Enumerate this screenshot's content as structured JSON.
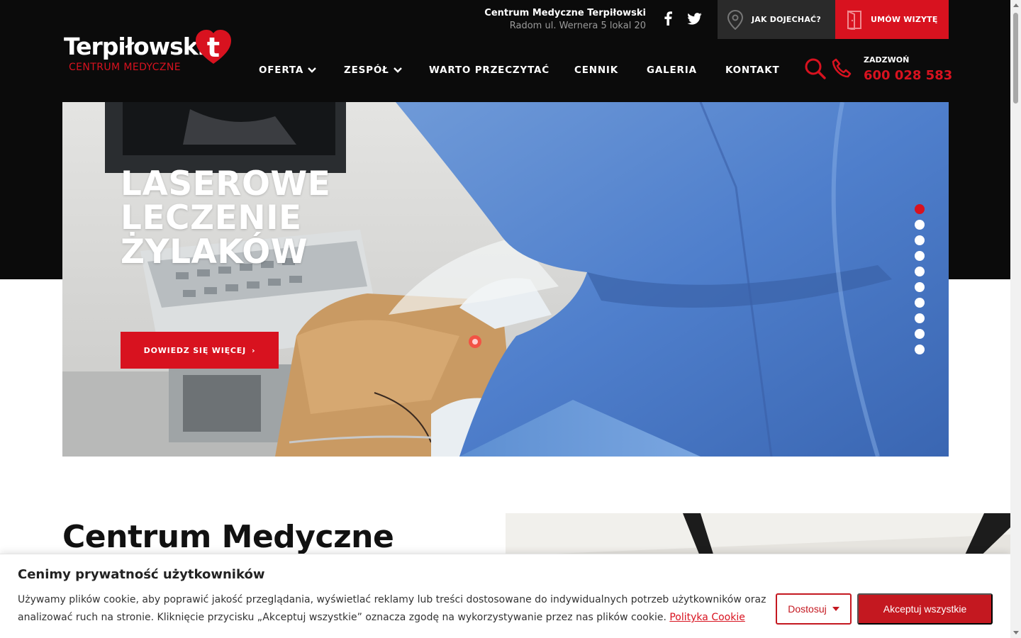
{
  "top_bar": {
    "clinic_name": "Centrum Medyczne Terpiłowski",
    "address": "Radom ul. Wernera 5 lokal 20",
    "directions_label": "JAK DOJECHAĆ?",
    "visit_label": "UMÓW WIZYTĘ"
  },
  "logo": {
    "wordmark": "Terpiłowski",
    "subline": "CENTRUM MEDYCZNE",
    "mark_letter": "t"
  },
  "nav": {
    "items": [
      {
        "label": "OFERTA"
      },
      {
        "label": "ZESPÓŁ"
      },
      {
        "label": "WARTO PRZECZYTAĆ"
      },
      {
        "label": "CENNIK"
      },
      {
        "label": "GALERIA"
      },
      {
        "label": "KONTAKT"
      }
    ],
    "call_label": "ZADZWOŃ",
    "phone": "600 028 583"
  },
  "hero": {
    "title": "LASEROWE\nLECZENIE\nŻYLAKÓW",
    "cta_label": "DOWIEDZ SIĘ WIĘCEJ",
    "cta_arrow": "›",
    "slide_count": 10,
    "active_slide": 1
  },
  "section": {
    "heading": "Centrum Medyczne"
  },
  "cookie": {
    "title": "Cenimy prywatność użytkowników",
    "text": "Używamy plików cookie, aby poprawić jakość przeglądania, wyświetlać reklamy lub treści dostosowane do indywidualnych potrzeb użytkowników oraz analizować ruch na stronie. Kliknięcie przycisku „Akceptuj wszystkie” oznacza zgodę na wykorzystywanie przez nas plików cookie.",
    "policy_link": "Polityka Cookie",
    "customize_label": "Dostosuj",
    "accept_label": "Akceptuj wszystkie"
  },
  "colors": {
    "brand_red": "#d8121f",
    "header_black": "#0b0b0b",
    "directions_gray": "#2a2a2a"
  },
  "icons": [
    "facebook-icon",
    "twitter-icon",
    "map-pin-icon",
    "door-icon",
    "search-icon",
    "phone-icon",
    "chevron-down-icon",
    "caret-down-icon"
  ]
}
